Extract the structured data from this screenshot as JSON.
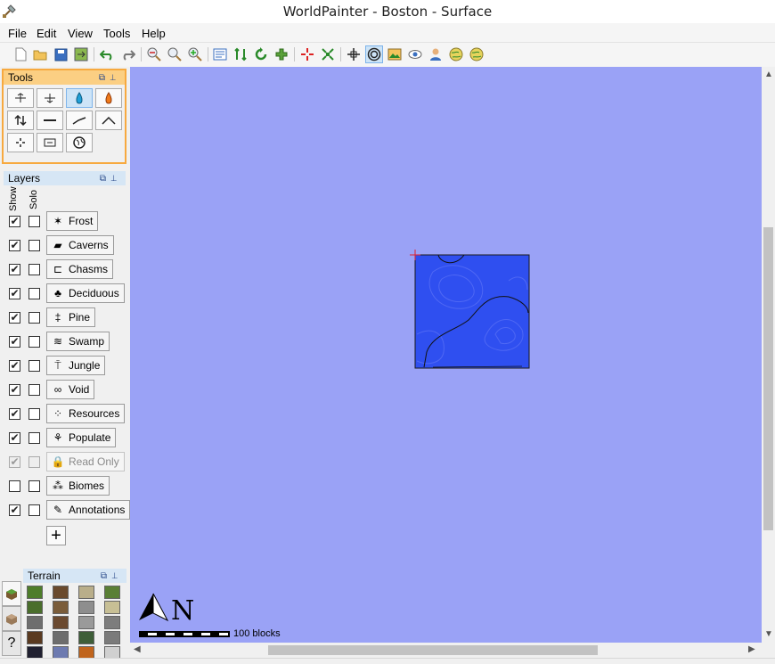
{
  "window": {
    "title": "WorldPainter - Boston - Surface",
    "app_icon": "shovel-icon"
  },
  "menu": [
    "File",
    "Edit",
    "View",
    "Tools",
    "Help"
  ],
  "toolbar_icons": [
    "new-world-icon",
    "open-world-icon",
    "save-world-icon",
    "export-world-icon",
    "undo-icon",
    "redo-icon",
    "zoom-out-icon",
    "zoom-reset-icon",
    "zoom-in-icon",
    "dimension-properties-icon",
    "height-level-icon",
    "rotate-icon",
    "biomes-icon",
    "move-to-spawn-icon",
    "move-to-origin-icon",
    "grid-icon",
    "contours-icon",
    "image-overlay-icon",
    "view-icon",
    "players-icon",
    "globe-icon",
    "globe-2-icon"
  ],
  "tools_panel": {
    "title": "Tools",
    "tools": [
      "raise-lower-icon",
      "smooth-icon",
      "flood-icon",
      "lava-icon",
      "height-icon",
      "flatten-icon",
      "slope-icon",
      "mountain-icon",
      "spray-icon",
      "text-icon",
      "globe-icon"
    ]
  },
  "layers_panel": {
    "title": "Layers",
    "col_show": "Show",
    "col_solo": "Solo",
    "layers": [
      {
        "name": "Frost",
        "show": true,
        "solo": false,
        "icon": "snowflake-icon",
        "glyph": "✶",
        "enabled": true
      },
      {
        "name": "Caverns",
        "show": true,
        "solo": false,
        "icon": "cave-icon",
        "glyph": "▰",
        "enabled": true
      },
      {
        "name": "Chasms",
        "show": true,
        "solo": false,
        "icon": "chasm-icon",
        "glyph": "⊏",
        "enabled": true
      },
      {
        "name": "Deciduous",
        "show": true,
        "solo": false,
        "icon": "deciduous-tree-icon",
        "glyph": "♣",
        "enabled": true
      },
      {
        "name": "Pine",
        "show": true,
        "solo": false,
        "icon": "pine-tree-icon",
        "glyph": "‡",
        "enabled": true
      },
      {
        "name": "Swamp",
        "show": true,
        "solo": false,
        "icon": "swamp-icon",
        "glyph": "≋",
        "enabled": true
      },
      {
        "name": "Jungle",
        "show": true,
        "solo": false,
        "icon": "jungle-icon",
        "glyph": "⍑",
        "enabled": true
      },
      {
        "name": "Void",
        "show": true,
        "solo": false,
        "icon": "void-icon",
        "glyph": "∞",
        "enabled": true
      },
      {
        "name": "Resources",
        "show": true,
        "solo": false,
        "icon": "resources-icon",
        "glyph": "⁘",
        "enabled": true
      },
      {
        "name": "Populate",
        "show": true,
        "solo": false,
        "icon": "populate-icon",
        "glyph": "⚘",
        "enabled": true
      },
      {
        "name": "Read Only",
        "show": true,
        "solo": false,
        "icon": "lock-icon",
        "glyph": "🔒",
        "enabled": false
      },
      {
        "name": "Biomes",
        "show": false,
        "solo": false,
        "icon": "biomes-icon",
        "glyph": "⁂",
        "enabled": true
      },
      {
        "name": "Annotations",
        "show": true,
        "solo": false,
        "icon": "pencil-icon",
        "glyph": "✎",
        "enabled": true
      }
    ],
    "add_label": "+"
  },
  "terrain_panel": {
    "title": "Terrain",
    "tabs": [
      "grass-tab-icon",
      "terrain-tab-icon",
      "help-tab-icon"
    ],
    "help_tab_label": "?",
    "tile_colors": [
      [
        "#4e7d2a",
        "#6a4a2d",
        "#b9ae8a",
        "#5a7f36"
      ],
      [
        "#4a6e2c",
        "#7a5c3a",
        "#8e8e8e",
        "#c7bf95"
      ],
      [
        "#6e6e6e",
        "#6b4a30",
        "#9a9a9a",
        "#7d7d7d"
      ],
      [
        "#5a3a20",
        "#6d6d6d",
        "#3e5e38",
        "#7b7b7b"
      ],
      [
        "#202030",
        "#6d7ab0",
        "#c0641c",
        "#d0d0d0"
      ]
    ]
  },
  "map": {
    "background": "#9aa2f6",
    "tile_color": "#2f4ff0",
    "scale_label": "100 blocks",
    "north_label": "N"
  }
}
